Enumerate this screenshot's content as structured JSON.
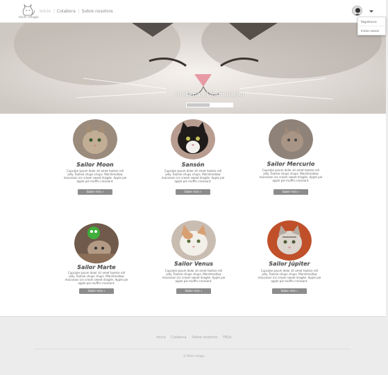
{
  "brand": {
    "name": "michi refugio"
  },
  "nav": {
    "items": [
      {
        "label": "Inicio"
      },
      {
        "label": "Colabora"
      },
      {
        "label": "Sobre nosotros"
      }
    ],
    "user_menu": [
      {
        "label": "Registrarse"
      },
      {
        "label": "Iniciar sesion"
      }
    ]
  },
  "hero": {
    "title": "¡Rellena el formulario!",
    "progress": 0.5
  },
  "cats": [
    {
      "name": "Sailor Moon",
      "desc": "Cupcake ipsum dolor sit amet tootsie roll jelly. Tootsie chups chups. Marshmallow macaroon ice cream sweet dragée. Apple pie apple pie muffin croissant.",
      "button": "Saber más »"
    },
    {
      "name": "Sansón",
      "desc": "Cupcake ipsum dolor sit amet tootsie roll jelly. Tootsie chups chups. Marshmallow macaroon ice cream sweet dragée. Apple pie apple pie muffin croissant.",
      "button": "Saber más »"
    },
    {
      "name": "Sailor Mercurio",
      "desc": "Cupcake ipsum dolor sit amet tootsie roll jelly. Tootsie chups chups. Marshmallow macaroon ice cream sweet dragée. Apple pie apple pie muffin croissant.",
      "button": "Saber más »"
    },
    {
      "name": "Sailor Marte",
      "desc": "Cupcake ipsum dolor sit amet tootsie roll jelly. Tootsie chups chups. Marshmallow macaroon ice cream sweet dragée. Apple pie apple pie muffin croissant.",
      "button": "Saber más »"
    },
    {
      "name": "Sailor Venus",
      "desc": "Cupcake ipsum dolor sit amet tootsie roll jelly. Tootsie chups chups. Marshmallow macaroon ice cream sweet dragée. Apple pie apple pie muffin croissant.",
      "button": "Saber más »"
    },
    {
      "name": "Sailor Júpiter",
      "desc": "Cupcake ipsum dolor sit amet tootsie roll jelly. Tootsie chups chups. Marshmallow macaroon ice cream sweet dragée. Apple pie apple pie muffin croissant.",
      "button": "Saber más »"
    }
  ],
  "footer": {
    "links": [
      {
        "label": "Inicio"
      },
      {
        "label": "Colabora"
      },
      {
        "label": "Sobre nosotros"
      },
      {
        "label": "FAQs"
      }
    ],
    "copyright": "© Michi refugio"
  },
  "colors": {
    "button": "#8c8c8c",
    "footer_bg": "#ececec",
    "accent_red": "#c0502a"
  }
}
